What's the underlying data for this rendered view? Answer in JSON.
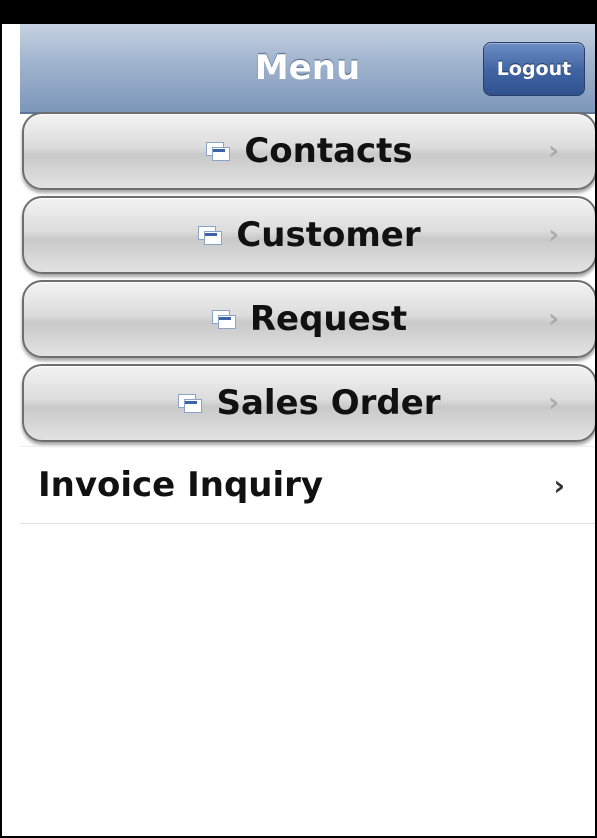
{
  "header": {
    "title": "Menu",
    "logout_label": "Logout"
  },
  "menu": {
    "items": [
      {
        "label": "Contacts",
        "icon": "document-icon"
      },
      {
        "label": "Customer",
        "icon": "document-icon"
      },
      {
        "label": "Request",
        "icon": "document-icon"
      },
      {
        "label": "Sales Order",
        "icon": "document-icon"
      }
    ]
  },
  "list": {
    "items": [
      {
        "label": "Invoice Inquiry"
      }
    ]
  },
  "glyphs": {
    "chevron": "›"
  },
  "colors": {
    "header": "#9fb3cd",
    "logout": "#3f62a1",
    "menu_button": "#dcdcdc"
  }
}
